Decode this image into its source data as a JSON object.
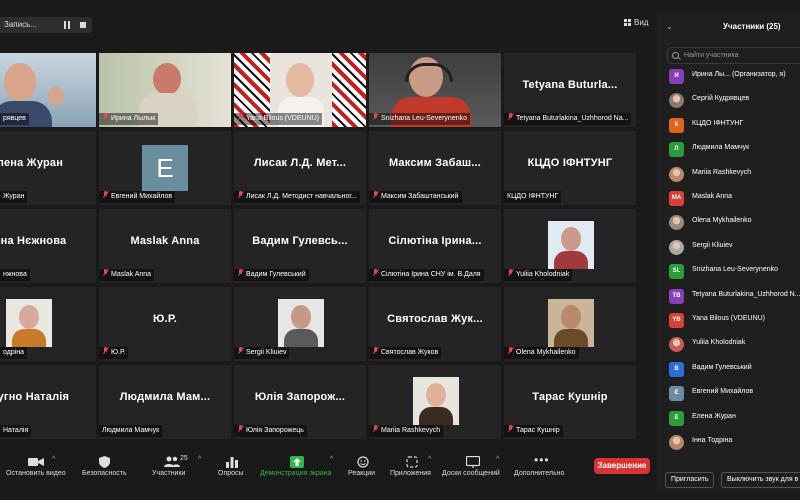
{
  "top": {
    "recording_label": "Запись...",
    "view_label": "Вид"
  },
  "tiles": [
    {
      "caption": "рявцев",
      "bigname": "",
      "mic": false
    },
    {
      "caption": "Ирина Лылык",
      "bigname": "",
      "mic": true
    },
    {
      "caption": "Yana Bilous (VDEUNU)",
      "bigname": "",
      "mic": true
    },
    {
      "caption": "Snizhana Leu-Severynenko",
      "bigname": "",
      "mic": true
    },
    {
      "caption": "Tetyana Buturlakina_Uzhhorod Na...",
      "bigname": "Tetyana  Buturla...",
      "mic": true
    },
    {
      "caption": "Журан",
      "bigname": "лена Журан",
      "mic": false
    },
    {
      "caption": "Евгений Михайлов",
      "bigname": "",
      "mic": true,
      "letter": "E"
    },
    {
      "caption": "Лисак Л.Д. Методист навчальног...",
      "bigname": "Лисак Л.Д. Мет...",
      "mic": true
    },
    {
      "caption": "Максим Забаштанський",
      "bigname": "Максим Забаш...",
      "mic": true
    },
    {
      "caption": "КЦДО ІФНТУНГ",
      "bigname": "КЦДО ІФНТУНГ",
      "mic": false
    },
    {
      "caption": "нжнова",
      "bigname": "ина Нєжнова",
      "mic": false
    },
    {
      "caption": "Maslak Anna",
      "bigname": "Maslak Anna",
      "mic": true
    },
    {
      "caption": "Вадим Гулевський",
      "bigname": "Вадим  Гулевсь...",
      "mic": true
    },
    {
      "caption": "Сілютіна Ірина СНУ ім. В.Даля",
      "bigname": "Сілютіна Ірина...",
      "mic": true
    },
    {
      "caption": "Yuliia Kholodniak",
      "bigname": "",
      "mic": true
    },
    {
      "caption": "одріна",
      "bigname": "",
      "mic": false
    },
    {
      "caption": "Ю.Р.",
      "bigname": "Ю.Р.",
      "mic": true
    },
    {
      "caption": "Sergii Kliuiev",
      "bigname": "",
      "mic": true
    },
    {
      "caption": "Святослав Жуков",
      "bigname": "Святослав  Жук...",
      "mic": true
    },
    {
      "caption": "Olena Mykhailenko",
      "bigname": "",
      "mic": true
    },
    {
      "caption": "Наталія",
      "bigname": "ругно Наталія",
      "mic": false
    },
    {
      "caption": "Людмила Мамчук",
      "bigname": "Людмила  Мам...",
      "mic": false
    },
    {
      "caption": "Юлія Запорожець",
      "bigname": "Юлія  Запорож...",
      "mic": true
    },
    {
      "caption": "Mariia Rashkevych",
      "bigname": "",
      "mic": true
    },
    {
      "caption": "Тарас Кушнір",
      "bigname": "Тарас Кушнір",
      "mic": true
    }
  ],
  "sidebar": {
    "title": "Участники (25)",
    "search_placeholder": "Найти участника",
    "participants": [
      {
        "initials": "И",
        "color": "#8a3fb8",
        "name": "Ирина Лы... (Организатор, я)"
      },
      {
        "initials": "",
        "color": "#8e7a6a",
        "name": "Сергій Кудрявцев"
      },
      {
        "initials": "К",
        "color": "#e0631e",
        "name": "КЦДО ІФНТУНГ"
      },
      {
        "initials": "Л",
        "color": "#2a9d3a",
        "name": "Людмила Мамчук"
      },
      {
        "initials": "",
        "color": "#b88a6a",
        "name": "Mariia Rashkevych"
      },
      {
        "initials": "MA",
        "color": "#d9403a",
        "name": "Maslak Anna"
      },
      {
        "initials": "",
        "color": "#9a8a78",
        "name": "Olena Mykhailenko"
      },
      {
        "initials": "",
        "color": "#a8a8a8",
        "name": "Sergii Kliuiev"
      },
      {
        "initials": "SL",
        "color": "#2a9d3a",
        "name": "Snizhana Leu-Severynenko"
      },
      {
        "initials": "TB",
        "color": "#8a3fb8",
        "name": "Tetyana Buturlakina_Uzhhorod N..."
      },
      {
        "initials": "YB",
        "color": "#d9403a",
        "name": "Yana Bilous (VDEUNU)"
      },
      {
        "initials": "",
        "color": "#c85a5a",
        "name": "Yuliia Kholodniak"
      },
      {
        "initials": "В",
        "color": "#2a6fd9",
        "name": "Вадим Гулевський"
      },
      {
        "initials": "E",
        "color": "#6b8e9e",
        "name": "Евгений Михайлов"
      },
      {
        "initials": "E",
        "color": "#2a9d3a",
        "name": "Елена Журан"
      },
      {
        "initials": "",
        "color": "#b8866a",
        "name": "Інна Тодріна"
      }
    ],
    "invite_label": "Пригласить",
    "mute_all_label": "Выключить звук для в"
  },
  "toolbar": {
    "stop_video": "Остановить видео",
    "security": "Безопасность",
    "participants": "Участники",
    "participants_count": "25",
    "polls": "Опросы",
    "share_screen": "Демонстрация экрана",
    "reactions": "Реакции",
    "apps": "Приложения",
    "chat": "Доски сообщений",
    "more": "Дополнительно",
    "end": "Завершение"
  }
}
